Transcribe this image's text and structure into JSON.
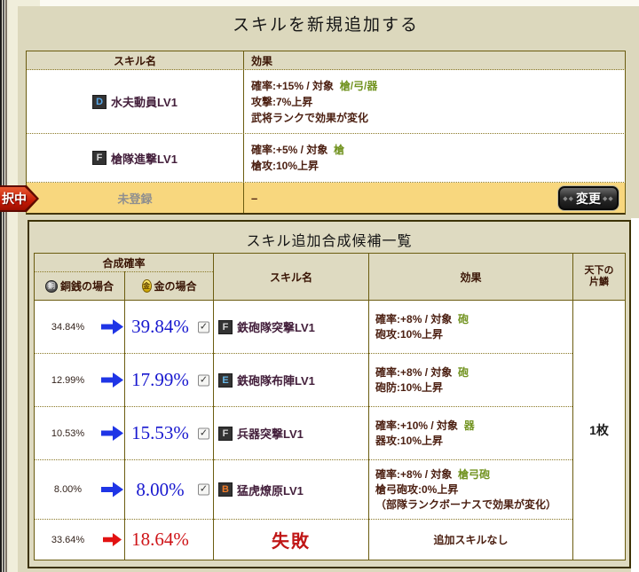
{
  "page": {
    "title": "スキルを新規追加する",
    "selected_marker": "択中"
  },
  "colors": {
    "highlight_row": "#f8d77e",
    "gold_percent_blue": "#1818cf",
    "failure_red": "#c01616",
    "target_green": "#739422",
    "grade_D": "#58a8e8",
    "grade_E": "#68b8e8",
    "grade_F": "#d4d4d4",
    "grade_B": "#f07b28"
  },
  "current_skills": {
    "header": {
      "name": "スキル名",
      "effect": "効果"
    },
    "rows": [
      {
        "grade": "D",
        "name": "水夫動員LV1",
        "effect_prefix": "確率:+15% / 対象",
        "effect_target": "槍/弓/器",
        "effect_lines": [
          "攻撃:7%上昇",
          "武将ランクで効果が変化"
        ]
      },
      {
        "grade": "F",
        "name": "槍隊進撃LV1",
        "effect_prefix": "確率:+5% / 対象",
        "effect_target": "槍",
        "effect_lines": [
          "槍攻:10%上昇"
        ]
      }
    ],
    "unregistered": {
      "name": "未登録",
      "effect": "–",
      "change_button": "変更"
    }
  },
  "synth": {
    "title": "スキル追加合成候補一覧",
    "header": {
      "probability": "合成確率",
      "copper_coin": "銅",
      "copper_case": "銅銭の場合",
      "gold_coin": "金",
      "gold_case": "金の場合",
      "skill_name": "スキル名",
      "effect": "効果",
      "fragment_line1": "天下の",
      "fragment_line2": "片鱗"
    },
    "check_glyph": "✓",
    "rows": [
      {
        "copper": "34.84%",
        "gold": "39.84%",
        "checked": true,
        "grade": "F",
        "name": "鉄砲隊突撃LV1",
        "effect_prefix": "確率:+8% / 対象",
        "effect_target": "砲",
        "effect_lines": [
          "砲攻:10%上昇"
        ]
      },
      {
        "copper": "12.99%",
        "gold": "17.99%",
        "checked": true,
        "grade": "E",
        "name": "鉄砲隊布陣LV1",
        "effect_prefix": "確率:+8% / 対象",
        "effect_target": "砲",
        "effect_lines": [
          "砲防:10%上昇"
        ]
      },
      {
        "copper": "10.53%",
        "gold": "15.53%",
        "checked": true,
        "grade": "F",
        "name": "兵器突撃LV1",
        "effect_prefix": "確率:+10% / 対象",
        "effect_target": "器",
        "effect_lines": [
          "器攻:10%上昇"
        ]
      },
      {
        "copper": "8.00%",
        "gold": "8.00%",
        "checked": true,
        "grade": "B",
        "name": "猛虎燎原LV1",
        "effect_prefix": "確率:+8% / 対象",
        "effect_target": "槍弓砲",
        "effect_lines": [
          "槍弓砲攻:0%上昇",
          "（部隊ランクボーナスで効果が変化）"
        ]
      }
    ],
    "failure": {
      "copper": "33.64%",
      "gold": "18.64%",
      "label": "失敗",
      "effect": "追加スキルなし"
    },
    "fragment_value": "1枚"
  }
}
